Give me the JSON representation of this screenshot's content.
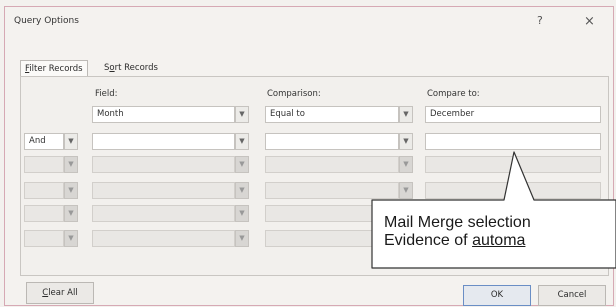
{
  "dialog": {
    "title": "Query Options",
    "help_label": "?",
    "close_label": "×"
  },
  "tabs": [
    {
      "prefix": "",
      "accel": "F",
      "rest": "ilter Records",
      "active": true
    },
    {
      "prefix": "S",
      "accel": "o",
      "rest": "rt Records",
      "active": false
    }
  ],
  "columns": {
    "field": "Field:",
    "comparison": "Comparison:",
    "compare_to": "Compare to:"
  },
  "rows": [
    {
      "operator": "",
      "field": "Month",
      "comparison": "Equal to",
      "compare_to": "December",
      "enabled": true
    },
    {
      "operator": "And",
      "field": "",
      "comparison": "",
      "compare_to": "",
      "enabled": true
    },
    {
      "operator": "",
      "field": "",
      "comparison": "",
      "compare_to": "",
      "enabled": false
    },
    {
      "operator": "",
      "field": "",
      "comparison": "",
      "compare_to": "",
      "enabled": false
    },
    {
      "operator": "",
      "field": "",
      "comparison": "",
      "compare_to": "",
      "enabled": false
    },
    {
      "operator": "",
      "field": "",
      "comparison": "",
      "compare_to": "",
      "enabled": false
    }
  ],
  "buttons": {
    "clear_accel": "C",
    "clear_rest": "lear All",
    "ok": "OK",
    "cancel": "Cancel"
  },
  "callout": {
    "line1": "Mail Merge selection",
    "line2_prefix": "Evidence of ",
    "line2_link": "automa"
  },
  "icons": {
    "dropdown": "chevron-down-icon"
  }
}
